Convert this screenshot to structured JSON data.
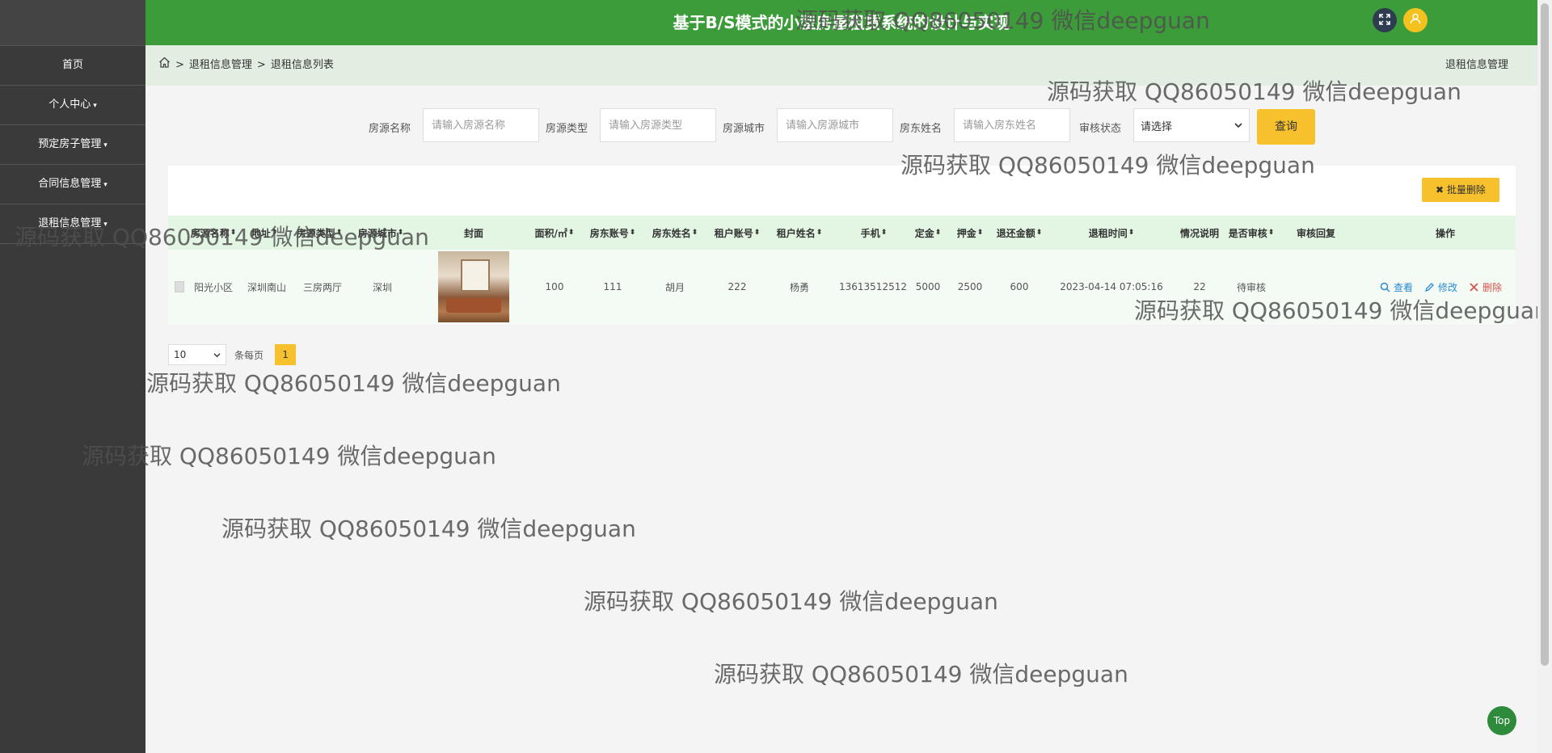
{
  "header": {
    "title": "基于B/S模式的小型房屋租赁系统的设计与实现",
    "fullscreen_icon": "expand-icon",
    "user_icon": "user-icon"
  },
  "sidebar": {
    "items": [
      {
        "label": "首页",
        "caret": ""
      },
      {
        "label": "个人中心",
        "caret": "▾"
      },
      {
        "label": "预定房子管理",
        "caret": "▾"
      },
      {
        "label": "合同信息管理",
        "caret": "▾"
      },
      {
        "label": "退租信息管理",
        "caret": "▾"
      }
    ]
  },
  "breadcrumb": {
    "sep": ">",
    "level1": "退租信息管理",
    "level2": "退租信息列表",
    "right": "退租信息管理"
  },
  "search": {
    "fields": [
      {
        "label": "房源名称",
        "placeholder": "请输入房源名称"
      },
      {
        "label": "房源类型",
        "placeholder": "请输入房源类型"
      },
      {
        "label": "房源城市",
        "placeholder": "请输入房源城市"
      },
      {
        "label": "房东姓名",
        "placeholder": "请输入房东姓名"
      }
    ],
    "status_label": "审核状态",
    "status_value": "请选择",
    "button": "查询"
  },
  "table": {
    "bulk_delete": "批量删除",
    "columns": [
      "房源名称",
      "地址",
      "房源类型",
      "房源城市",
      "封面",
      "面积/㎡",
      "房东账号",
      "房东姓名",
      "租户账号",
      "租户姓名",
      "手机",
      "定金",
      "押金",
      "退还金额",
      "退租时间",
      "情况说明",
      "是否审核",
      "审核回复",
      "操作"
    ],
    "sort_mark": "⬍",
    "rows": [
      {
        "name": "阳光小区",
        "address": "深圳南山",
        "type": "三房两厅",
        "city": "深圳",
        "area": "100",
        "landlord_account": "111",
        "landlord_name": "胡月",
        "tenant_account": "222",
        "tenant_name": "杨勇",
        "phone": "13613512512",
        "deposit": "5000",
        "security": "2500",
        "refund": "600",
        "time": "2023-04-14 07:05:16",
        "note": "22",
        "audit": "待审核",
        "reply": ""
      }
    ],
    "actions": {
      "view": "查看",
      "edit": "修改",
      "delete": "删除"
    }
  },
  "pagination": {
    "page_size": "10",
    "per_page_label": "条每页",
    "current_page": "1"
  },
  "top_button": "Top",
  "watermark": "源码获取 QQ86050149 微信deepguan"
}
